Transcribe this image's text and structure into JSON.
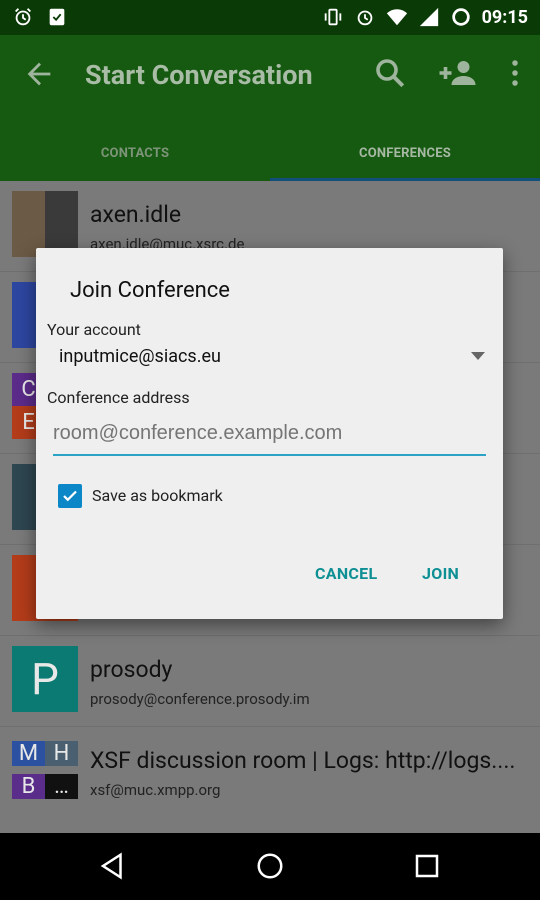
{
  "status_bar": {
    "time": "09:15",
    "icons_left": [
      "alarm-icon",
      "clipboard-check-icon"
    ],
    "icons_right": [
      "vibrate-icon",
      "alarm-icon",
      "wifi-icon",
      "signal-icon",
      "battery-icon"
    ]
  },
  "app_bar": {
    "title": "Start Conversation",
    "tabs": [
      {
        "label": "CONTACTS",
        "active": false
      },
      {
        "label": "CONFERENCES",
        "active": true
      }
    ],
    "colors": {
      "bar": "#165a12",
      "status": "#0a3a06",
      "tab_indicator": "#0f4f7a"
    }
  },
  "list": [
    {
      "name": "axen.idle",
      "sub": "axen.idle@muc.xsrc.de",
      "avatar": "photo",
      "colors": [
        "#6b5a45",
        "#3a3a3a"
      ]
    },
    {
      "name": "",
      "sub": "",
      "avatar": "",
      "colors": [
        "#2d46a0"
      ]
    },
    {
      "name": "",
      "sub": "",
      "avatar": "C E",
      "colors": [
        "#5b2b8a",
        "#b33c1a"
      ]
    },
    {
      "name": "",
      "sub": "",
      "avatar": "",
      "colors": [
        "#2e4650"
      ]
    },
    {
      "name": "",
      "sub": "",
      "avatar": "",
      "colors": [
        "#b33c1a"
      ]
    },
    {
      "name": "prosody",
      "sub": "prosody@conference.prosody.im",
      "avatar": "P",
      "colors": [
        "#0b7a72"
      ]
    },
    {
      "name": "XSF discussion room | Logs: http://logs....",
      "sub": "xsf@muc.xmpp.org",
      "avatar": "M H B …",
      "colors": [
        "#2b51a0",
        "#4a6070",
        "#5a2d8a",
        "#111111"
      ]
    }
  ],
  "dialog": {
    "title": "Join Conference",
    "account_label": "Your account",
    "account_value": "inputmice@siacs.eu",
    "address_label": "Conference address",
    "address_placeholder": "room@conference.example.com",
    "bookmark_label": "Save as bookmark",
    "bookmark_checked": true,
    "buttons": {
      "cancel": "CANCEL",
      "join": "JOIN"
    }
  },
  "nav_bar": {
    "buttons": [
      "back-triangle-icon",
      "home-circle-icon",
      "recents-square-icon"
    ]
  }
}
